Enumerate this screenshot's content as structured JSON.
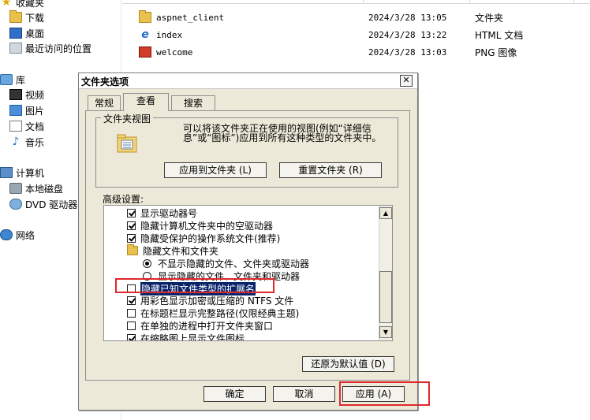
{
  "nav": {
    "favorites": "收藏夹",
    "downloads": "下载",
    "desktop": "桌面",
    "recent": "最近访问的位置",
    "libraries": "库",
    "videos": "视频",
    "pictures": "图片",
    "documents": "文档",
    "music": "音乐",
    "computer": "计算机",
    "local_disk": "本地磁盘",
    "dvd": "DVD 驱动器",
    "network": "网络"
  },
  "files": [
    {
      "name": "aspnet_client",
      "date": "2024/3/28 13:05",
      "type": "文件夹",
      "icon": "folder-icon"
    },
    {
      "name": "index",
      "date": "2024/3/28 13:22",
      "type": "HTML 文档",
      "icon": "ie-document-icon"
    },
    {
      "name": "welcome",
      "date": "2024/3/28 13:03",
      "type": "PNG 图像",
      "icon": "image-icon"
    }
  ],
  "dialog": {
    "title": "文件夹选项",
    "close_label": "✕",
    "tabs": [
      "常规",
      "查看",
      "搜索"
    ],
    "folder_views": {
      "title": "文件夹视图",
      "description": "可以将该文件夹正在使用的视图(例如“详细信息”或“图标”)应用到所有这种类型的文件夹中。",
      "apply_button": "应用到文件夹 (L)",
      "reset_button": "重置文件夹 (R)"
    },
    "advanced_label": "高级设置:",
    "options": [
      {
        "kind": "checkbox",
        "checked": true,
        "label": "显示驱动器号"
      },
      {
        "kind": "checkbox",
        "checked": true,
        "label": "隐藏计算机文件夹中的空驱动器"
      },
      {
        "kind": "checkbox",
        "checked": true,
        "label": "隐藏受保护的操作系统文件(推荐)"
      },
      {
        "kind": "folder",
        "label": "隐藏文件和文件夹"
      },
      {
        "kind": "radio",
        "checked": true,
        "label": "不显示隐藏的文件、文件夹或驱动器"
      },
      {
        "kind": "radio",
        "checked": false,
        "label": "显示隐藏的文件、文件夹和驱动器"
      },
      {
        "kind": "checkbox",
        "checked": false,
        "label": "隐藏已知文件类型的扩展名",
        "highlighted": true
      },
      {
        "kind": "checkbox",
        "checked": true,
        "label": "用彩色显示加密或压缩的 NTFS 文件"
      },
      {
        "kind": "checkbox",
        "checked": false,
        "label": "在标题栏显示完整路径(仅限经典主题)"
      },
      {
        "kind": "checkbox",
        "checked": false,
        "label": "在单独的进程中打开文件夹窗口"
      },
      {
        "kind": "checkbox",
        "checked": true,
        "label": "在缩略图上显示文件图标"
      }
    ],
    "restore_defaults": "还原为默认值 (D)",
    "ok": "确定",
    "cancel": "取消",
    "apply": "应用 (A)"
  },
  "colors": {
    "highlight": "#0a246a",
    "annotation": "#e0282c",
    "dialog_bg": "#ece9d8"
  }
}
